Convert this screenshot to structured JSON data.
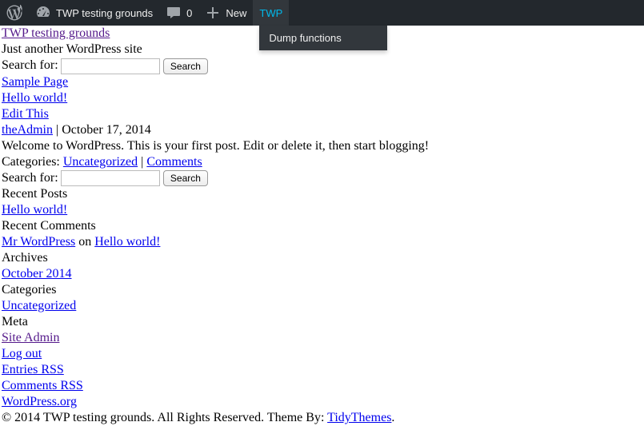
{
  "adminbar": {
    "site_name": "TWP testing grounds",
    "comment_count": "0",
    "new_label": "New",
    "twp_label": "TWP",
    "twp_submenu": {
      "dump_functions": "Dump functions"
    }
  },
  "header": {
    "site_title": "TWP testing grounds",
    "tagline": "Just another WordPress site"
  },
  "search": {
    "label": "Search for:",
    "button": "Search"
  },
  "nav": {
    "sample_page": "Sample Page"
  },
  "post": {
    "title": "Hello world!",
    "edit": "Edit This",
    "author": "theAdmin",
    "sep": " | ",
    "date": "October 17, 2014",
    "body": "Welcome to WordPress. This is your first post. Edit or delete it, then start blogging!",
    "categories_label": "Categories: ",
    "category": "Uncategorized",
    "cat_sep": " | ",
    "comments_link": "Comments"
  },
  "widgets": {
    "recent_posts": {
      "title": "Recent Posts",
      "items": [
        "Hello world!"
      ]
    },
    "recent_comments": {
      "title": "Recent Comments",
      "author": "Mr WordPress",
      "on": " on ",
      "post": "Hello world!"
    },
    "archives": {
      "title": "Archives",
      "items": [
        "October 2014"
      ]
    },
    "categories": {
      "title": "Categories",
      "items": [
        "Uncategorized"
      ]
    },
    "meta": {
      "title": "Meta",
      "site_admin": "Site Admin",
      "logout": "Log out",
      "entries_rss": "Entries RSS",
      "comments_rss": "Comments RSS",
      "wporg": "WordPress.org"
    }
  },
  "footer": {
    "prefix": "© 2014 TWP testing grounds. All Rights Reserved. Theme By: ",
    "theme_by": "TidyThemes",
    "suffix": "."
  }
}
